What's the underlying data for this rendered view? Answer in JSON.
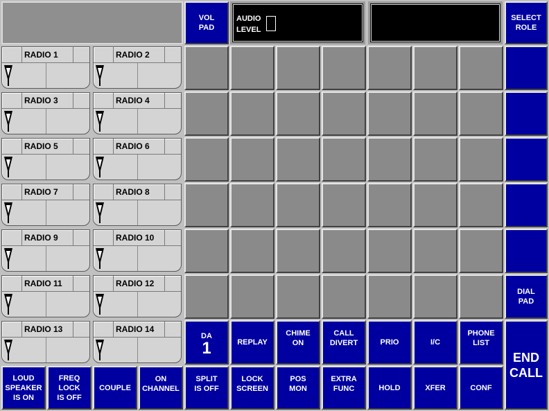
{
  "top": {
    "vol_pad": "VOL\nPAD",
    "audio_level": "AUDIO\nLEVEL",
    "select_role": "SELECT\nROLE"
  },
  "radios": [
    {
      "label": "RADIO 1"
    },
    {
      "label": "RADIO 2"
    },
    {
      "label": "RADIO 3"
    },
    {
      "label": "RADIO 4"
    },
    {
      "label": "RADIO 5"
    },
    {
      "label": "RADIO 6"
    },
    {
      "label": "RADIO 7"
    },
    {
      "label": "RADIO 8"
    },
    {
      "label": "RADIO 9"
    },
    {
      "label": "RADIO 10"
    },
    {
      "label": "RADIO 11"
    },
    {
      "label": "RADIO 12"
    },
    {
      "label": "RADIO 13"
    },
    {
      "label": "RADIO 14"
    }
  ],
  "right_column": {
    "dial_pad": "DIAL\nPAD",
    "end_call": "END\nCALL"
  },
  "row_functions": {
    "da_label": "DA",
    "da_number": "1",
    "replay": "REPLAY",
    "chime": "CHIME\nON",
    "call_divert": "CALL\nDIVERT",
    "prio": "PRIO",
    "ic": "I/C",
    "phone_list": "PHONE\nLIST"
  },
  "bottom_row": {
    "loudspeaker": "LOUD\nSPEAKER\nIS ON",
    "freq_lock": "FREQ\nLOCK\nIS OFF",
    "couple": "COUPLE",
    "on_channel": "ON\nCHANNEL",
    "split": "SPLIT\nIS OFF",
    "lock_screen": "LOCK\nSCREEN",
    "pos_mon": "POS\nMON",
    "extra_func": "EXTRA\nFUNC",
    "hold": "HOLD",
    "xfer": "XFER",
    "conf": "CONF"
  },
  "colors": {
    "button_blue": "#0000a0",
    "empty_grey": "#8a8a8a",
    "panel_grey": "#c0c0c0"
  },
  "icons": {
    "radio_mic": "microphone-icon"
  }
}
